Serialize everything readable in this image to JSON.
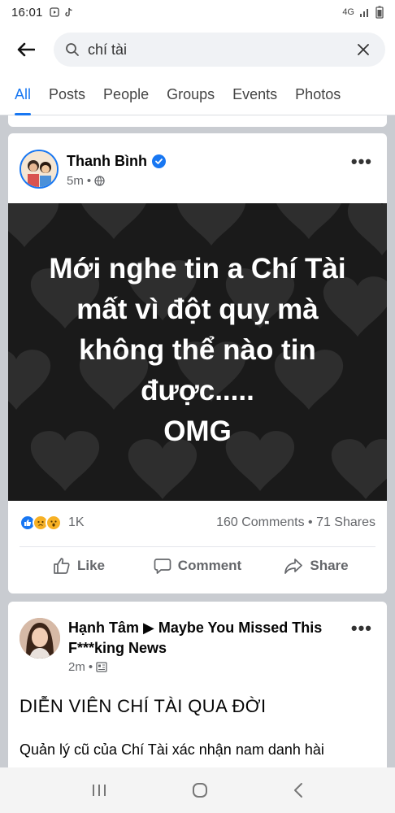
{
  "status": {
    "time": "16:01",
    "network": "4G"
  },
  "search": {
    "query": "chí tài"
  },
  "tabs": [
    {
      "label": "All"
    },
    {
      "label": "Posts"
    },
    {
      "label": "People"
    },
    {
      "label": "Groups"
    },
    {
      "label": "Events"
    },
    {
      "label": "Photos"
    }
  ],
  "post1": {
    "author": "Thanh Bình",
    "time": "5m",
    "image_lines": [
      "Mới nghe tin a Chí Tài",
      "mất vì đột quỵ mà",
      "không thể nào tin",
      "được.....",
      "OMG"
    ],
    "reaction_count": "1K",
    "stats": "160 Comments • 71 Shares",
    "like_label": "Like",
    "comment_label": "Comment",
    "share_label": "Share"
  },
  "post2": {
    "author_line": "Hạnh Tâm ▶ Maybe You Missed This F***king News",
    "time": "2m",
    "headline": "DIỄN VIÊN CHÍ TÀI QUA ĐỜI",
    "body": "Quản lý cũ của Chí Tài xác nhận nam danh hài"
  },
  "colors": {
    "accent": "#1877f2",
    "image_bg": "#1a1a1a"
  }
}
